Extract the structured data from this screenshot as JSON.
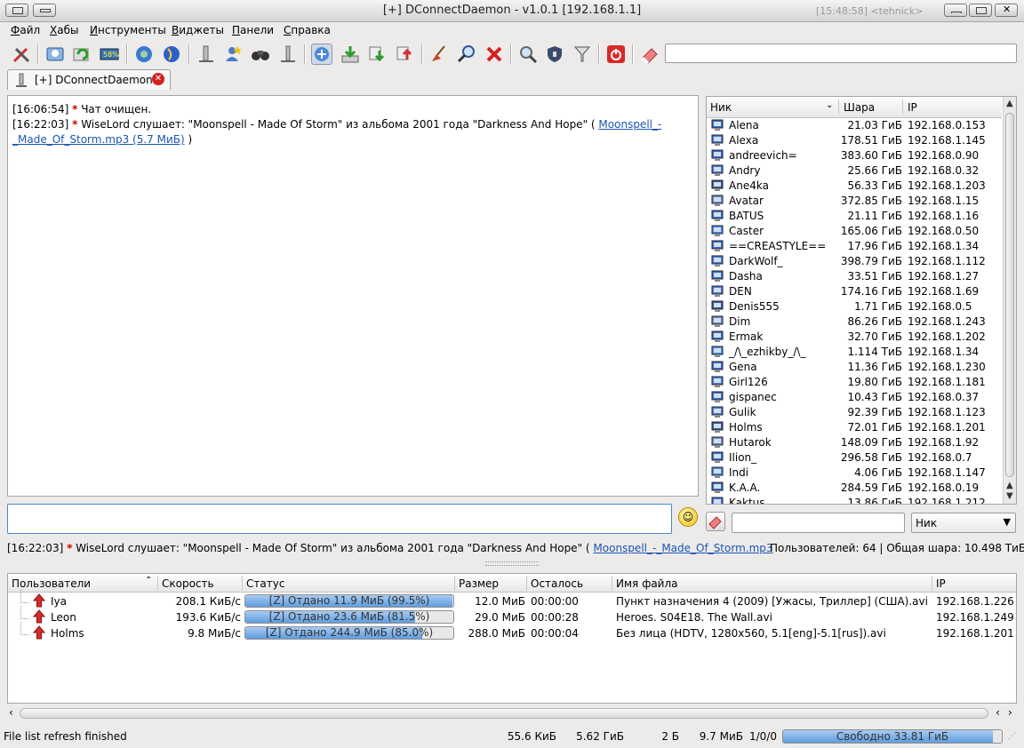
{
  "window": {
    "title": "[+] DConnectDaemon - v1.0.1 [192.168.1.1]",
    "ghost_text": "[15:48:58] <tehnick>"
  },
  "menu": [
    "Файл",
    "Хабы",
    "Инструменты",
    "Виджеты",
    "Панели",
    "Справка"
  ],
  "toolbar": {
    "icons": [
      "settings-icon",
      "public-hubs-icon",
      "reconnect-icon",
      "hash-progress-icon",
      "hub-icon",
      "globe-icon",
      "upload-queue-icon",
      "favorite-users-icon",
      "search-binoculars-icon",
      "download-queue-icon",
      "connect-icon",
      "download-icon",
      "download-to-icon",
      "upload-icon",
      "sweep-icon",
      "search-spy-icon",
      "close-icon",
      "find-icon",
      "security-icon",
      "filter-icon",
      "quit-icon",
      "clear-icon"
    ],
    "search_value": ""
  },
  "tab": {
    "label": "[+] DConnectDaemon"
  },
  "chat": {
    "lines": [
      {
        "time": "[16:06:54]",
        "star": "*",
        "text": "Чат очищен."
      },
      {
        "time": "[16:22:03]",
        "star": "*",
        "text": "WiseLord слушает: \"Moonspell - Made Of Storm\" из альбома 2001 года \"Darkness And Hope\" (",
        "link1": "Moonspell_-",
        "link2": "_Made_Of_Storm.mp3 (5.7 МиБ)",
        "tail": ")"
      }
    ]
  },
  "userlist": {
    "headers": {
      "nick": "Ник",
      "share": "Шара",
      "ip": "IP"
    },
    "users": [
      {
        "nick": "Alena",
        "share": "21.03 ГиБ",
        "ip": "192.168.0.153"
      },
      {
        "nick": "Alexa",
        "share": "178.51 ГиБ",
        "ip": "192.168.1.145"
      },
      {
        "nick": "andreevich=",
        "share": "383.60 ГиБ",
        "ip": "192.168.0.90"
      },
      {
        "nick": "Andry",
        "share": "25.66 ГиБ",
        "ip": "192.168.0.32"
      },
      {
        "nick": "Ane4ka",
        "share": "56.33 ГиБ",
        "ip": "192.168.1.203"
      },
      {
        "nick": "Avatar",
        "share": "372.85 ГиБ",
        "ip": "192.168.1.15"
      },
      {
        "nick": "BATUS",
        "share": "21.11 ГиБ",
        "ip": "192.168.1.16"
      },
      {
        "nick": "Caster",
        "share": "165.06 ГиБ",
        "ip": "192.168.0.50"
      },
      {
        "nick": "==CREASTYLE==",
        "share": "17.96 ГиБ",
        "ip": "192.168.1.34"
      },
      {
        "nick": "DarkWolf_",
        "share": "398.79 ГиБ",
        "ip": "192.168.1.112"
      },
      {
        "nick": "Dasha",
        "share": "33.51 ГиБ",
        "ip": "192.168.1.27"
      },
      {
        "nick": "DEN",
        "share": "174.16 ГиБ",
        "ip": "192.168.1.69"
      },
      {
        "nick": "Denis555",
        "share": "1.71 ГиБ",
        "ip": "192.168.0.5"
      },
      {
        "nick": "Dim",
        "share": "86.26 ГиБ",
        "ip": "192.168.1.243"
      },
      {
        "nick": "Ermak",
        "share": "32.70 ГиБ",
        "ip": "192.168.1.202"
      },
      {
        "nick": "_/\\_ezhikby_/\\_",
        "share": "1.114 ТиБ",
        "ip": "192.168.1.34"
      },
      {
        "nick": "Gena",
        "share": "11.36 ГиБ",
        "ip": "192.168.1.230"
      },
      {
        "nick": "Girl126",
        "share": "19.80 ГиБ",
        "ip": "192.168.1.181"
      },
      {
        "nick": "gispanec",
        "share": "10.43 ГиБ",
        "ip": "192.168.0.37"
      },
      {
        "nick": "Gulik",
        "share": "92.39 ГиБ",
        "ip": "192.168.1.123"
      },
      {
        "nick": "Holms",
        "share": "72.01 ГиБ",
        "ip": "192.168.1.201"
      },
      {
        "nick": "Hutarok",
        "share": "148.09 ГиБ",
        "ip": "192.168.1.92"
      },
      {
        "nick": "Ilion_",
        "share": "296.58 ГиБ",
        "ip": "192.168.0.7"
      },
      {
        "nick": "Indi",
        "share": "4.06 ГиБ",
        "ip": "192.168.1.147"
      },
      {
        "nick": "K.A.A.",
        "share": "284.59 ГиБ",
        "ip": "192.168.0.19"
      },
      {
        "nick": "Kaktus",
        "share": "13.86 ГиБ",
        "ip": "192.168.1.212"
      }
    ]
  },
  "input": {
    "message_value": "",
    "filter_value": "",
    "filter_field": "Ник"
  },
  "status_line": {
    "time": "[16:22:03]",
    "star": "*",
    "text": "WiseLord слушает: \"Moonspell - Made Of Storm\" из альбома 2001 года \"Darkness And Hope\" (",
    "link": "Moonspell_-_Made_Of_Storm.mp3",
    "summary": "Пользователей: 64 | Общая шара: 10.498 ТиБ"
  },
  "transfers": {
    "headers": {
      "users": "Пользователи",
      "speed": "Скорость",
      "status": "Статус",
      "size": "Размер",
      "left": "Осталось",
      "file": "Имя файла",
      "ip": "IP"
    },
    "rows": [
      {
        "user": "Iya",
        "speed": "208.1 КиБ/с",
        "status": "[Z] Отдано 11.9 МиБ (99.5%)",
        "progress": 0.995,
        "size": "12.0 МиБ",
        "left": "00:00:00",
        "file": "Пункт назначения 4 (2009) [Ужасы, Триллер] (США).avi",
        "ip": "192.168.1.226"
      },
      {
        "user": "Leon",
        "speed": "193.6 КиБ/с",
        "status": "[Z] Отдано 23.6 МиБ (81.5%)",
        "progress": 0.815,
        "size": "29.0 МиБ",
        "left": "00:00:28",
        "file": "Heroes. S04E18. The Wall.avi",
        "ip": "192.168.1.249"
      },
      {
        "user": "Holms",
        "speed": "9.8 МиБ/с",
        "status": "[Z] Отдано 244.9 МиБ (85.0%)",
        "progress": 0.85,
        "size": "288.0 МиБ",
        "left": "00:00:04",
        "file": "Без лица (HDTV, 1280x560, 5.1[eng]-5.1[rus]).avi",
        "ip": "192.168.1.201"
      }
    ]
  },
  "statusbar": {
    "message": "File list refresh finished",
    "down_speed": "55.6 КиБ",
    "down_total": "5.62 ГиБ",
    "up_speed": "2 Б",
    "up_total": "9.7 МиБ",
    "slots": "1/0/0",
    "free_space": "Свободно 33.81 ГиБ",
    "free_fraction": 0.96
  }
}
